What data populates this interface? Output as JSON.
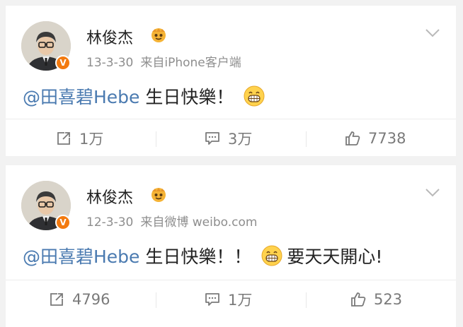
{
  "posts": [
    {
      "author": "林俊杰",
      "date": "13-3-30",
      "source": "来自iPhone客户端",
      "mention": "@田喜碧Hebe",
      "text_before_emoji": " 生日快樂！",
      "text_after_emoji": "",
      "repost_count": "1万",
      "comment_count": "3万",
      "like_count": "7738",
      "emoji": "grin-emoji"
    },
    {
      "author": "林俊杰",
      "date": "12-3-30",
      "source": "来自微博 weibo.com",
      "mention": "@田喜碧Hebe",
      "text_before_emoji": " 生日快樂！！",
      "text_after_emoji": "要天天開心!",
      "repost_count": "4796",
      "comment_count": "1万",
      "like_count": "523",
      "emoji": "grin-emoji"
    }
  ],
  "colors": {
    "mention": "#4a7ab0",
    "verified_badge": "#f37a0f",
    "meta_text": "#8e8e8e",
    "action_text": "#7a7a7a"
  },
  "badge": "V"
}
